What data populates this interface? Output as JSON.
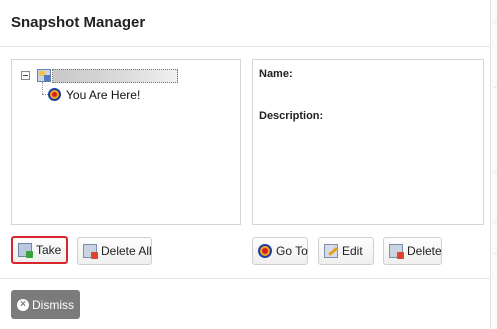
{
  "dialog": {
    "title": "Snapshot Manager"
  },
  "tree": {
    "root_name": "",
    "current_state_label": "You Are Here!"
  },
  "details": {
    "name_label": "Name:",
    "description_label": "Description:"
  },
  "buttons": {
    "take": "Take",
    "delete_all": "Delete All",
    "go_to": "Go To",
    "edit": "Edit",
    "delete": "Delete",
    "dismiss": "Dismiss"
  },
  "icons": {
    "take": "camera-add-icon",
    "delete_all": "snapshot-delete-icon",
    "go_to": "target-icon",
    "edit": "pencil-edit-icon",
    "delete": "snapshot-delete-icon",
    "dismiss": "close-circle-icon",
    "root": "vm-snapshot-icon",
    "current": "target-icon"
  },
  "colors": {
    "selected_outline": "#d9262c",
    "dismiss_bg": "#7b7b7b",
    "target_outer": "#1e3f9e",
    "target_middle": "#f4a51c",
    "target_inner": "#d42020"
  }
}
